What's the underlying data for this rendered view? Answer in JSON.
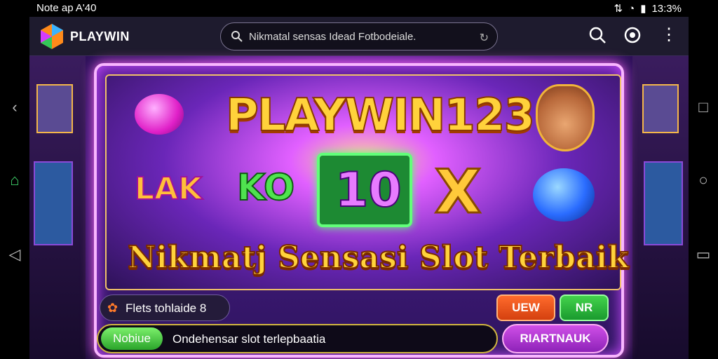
{
  "status_bar": {
    "time": "Note ap A'40",
    "clock": "13:3%"
  },
  "header": {
    "brand": "PLAYWIN",
    "search_text": "Nikmatal sensas Idead Fotbodeiale."
  },
  "banner": {
    "title": "PLAYWIN123",
    "symbols": [
      "LAK",
      "KO",
      "10",
      "X"
    ],
    "headline": "Nikmatj Sensasi Slot Terbaik"
  },
  "controls": {
    "chip_label": "Flets tohlaide 8",
    "btn_uew": "UEW",
    "btn_nr": "NR",
    "bar_pill": "Nobiue",
    "bar_text": "Ondehensar slot terlepbaatia",
    "btn_big": "RIARTNAUK"
  },
  "colors": {
    "accent_gold": "#ffd23b",
    "accent_purple": "#c94cff",
    "green": "#2aa42a",
    "orange": "#ff6b2c"
  },
  "icons": [
    "logo-icon",
    "search-icon",
    "refresh-icon",
    "magnify-icon",
    "settings-icon",
    "more-icon",
    "flower-icon",
    "back-icon",
    "home-icon",
    "recents-icon"
  ]
}
